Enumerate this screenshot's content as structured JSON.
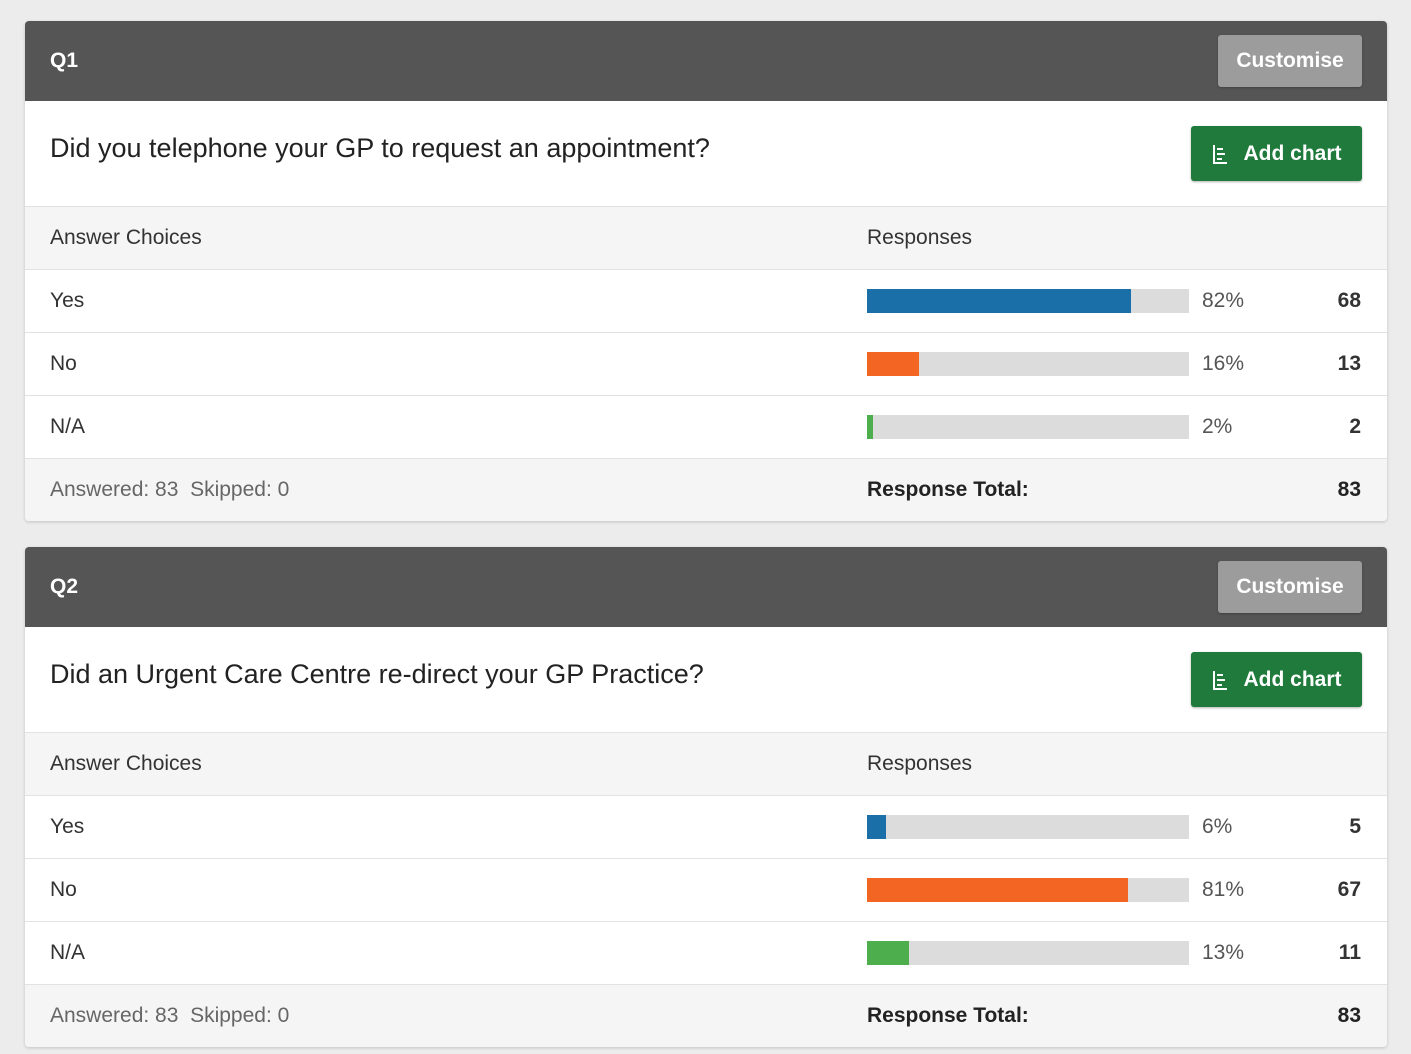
{
  "colors": {
    "yes": "#1a6fa8",
    "no": "#f26522",
    "na": "#4cae4c"
  },
  "questions": [
    {
      "label": "Q1",
      "customise_label": "Customise",
      "title": "Did you telephone your GP to request an appointment?",
      "add_chart_label": "Add chart",
      "col_choices": "Answer Choices",
      "col_responses": "Responses",
      "rows": [
        {
          "choice": "Yes",
          "percent_value": 82,
          "percent": "82%",
          "count": "68"
        },
        {
          "choice": "No",
          "percent_value": 16,
          "percent": "16%",
          "count": "13"
        },
        {
          "choice": "N/A",
          "percent_value": 2,
          "percent": "2%",
          "count": "2"
        }
      ],
      "answered_skipped": "Answered: 83  Skipped: 0",
      "response_total_label": "Response Total:",
      "response_total": "83"
    },
    {
      "label": "Q2",
      "customise_label": "Customise",
      "title": "Did an Urgent Care Centre re-direct your GP Practice?",
      "add_chart_label": "Add chart",
      "col_choices": "Answer Choices",
      "col_responses": "Responses",
      "rows": [
        {
          "choice": "Yes",
          "percent_value": 6,
          "percent": "6%",
          "count": "5"
        },
        {
          "choice": "No",
          "percent_value": 81,
          "percent": "81%",
          "count": "67"
        },
        {
          "choice": "N/A",
          "percent_value": 13,
          "percent": "13%",
          "count": "11"
        }
      ],
      "answered_skipped": "Answered: 83  Skipped: 0",
      "response_total_label": "Response Total:",
      "response_total": "83"
    }
  ]
}
